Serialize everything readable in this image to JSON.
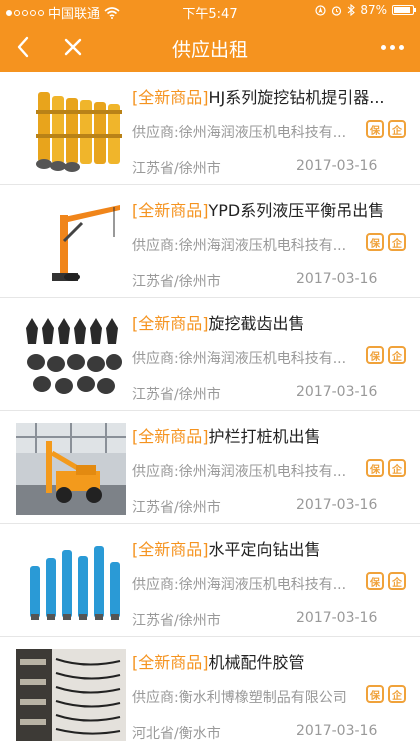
{
  "status_bar": {
    "carrier": "中国联通",
    "time": "下午5:47",
    "battery": "87%",
    "battery_level": 0.87
  },
  "nav": {
    "title": "供应出租"
  },
  "items": [
    {
      "tag": "[全新商品]",
      "name": "HJ系列旋挖钻机提引器...",
      "supplier": "供应商:徐州海润液压机电科技有...",
      "region": "江苏省/徐州市",
      "date": "2017-03-16",
      "badge1": "保",
      "badge2": "企"
    },
    {
      "tag": "[全新商品]",
      "name": "YPD系列液压平衡吊出售",
      "supplier": "供应商:徐州海润液压机电科技有...",
      "region": "江苏省/徐州市",
      "date": "2017-03-16",
      "badge1": "保",
      "badge2": "企"
    },
    {
      "tag": "[全新商品]",
      "name": "旋挖截齿出售",
      "supplier": "供应商:徐州海润液压机电科技有...",
      "region": "江苏省/徐州市",
      "date": "2017-03-16",
      "badge1": "保",
      "badge2": "企"
    },
    {
      "tag": "[全新商品]",
      "name": "护栏打桩机出售",
      "supplier": "供应商:徐州海润液压机电科技有...",
      "region": "江苏省/徐州市",
      "date": "2017-03-16",
      "badge1": "保",
      "badge2": "企"
    },
    {
      "tag": "[全新商品]",
      "name": "水平定向钻出售",
      "supplier": "供应商:徐州海润液压机电科技有...",
      "region": "江苏省/徐州市",
      "date": "2017-03-16",
      "badge1": "保",
      "badge2": "企"
    },
    {
      "tag": "[全新商品]",
      "name": "机械配件胶管",
      "supplier": "供应商:衡水利博橡塑制品有限公司",
      "region": "河北省/衡水市",
      "date": "2017-03-16",
      "badge1": "保",
      "badge2": "企"
    }
  ],
  "colors": {
    "accent": "#f5931f",
    "tag": "#f5931f",
    "muted": "#999999"
  }
}
